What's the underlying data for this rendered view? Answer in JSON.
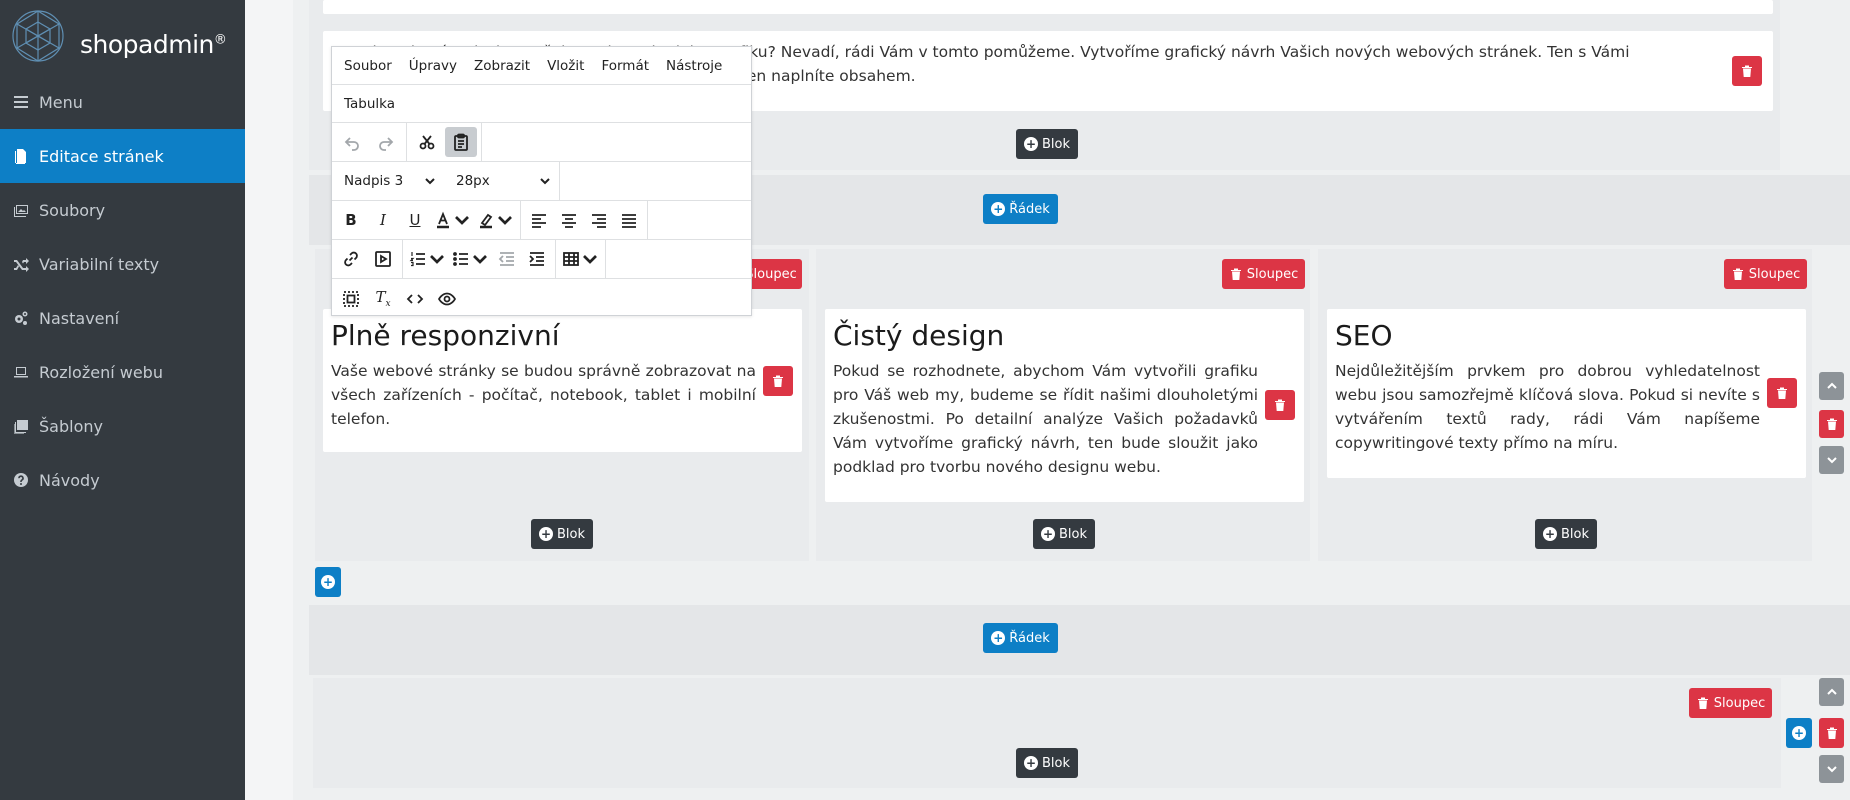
{
  "app": {
    "logo_text": "shopadmin",
    "logo_mark": "®"
  },
  "sidebar": {
    "items": [
      {
        "label": "Menu",
        "icon": "bars-icon",
        "active": false
      },
      {
        "label": "Editace stránek",
        "icon": "file-icon",
        "active": true
      },
      {
        "label": "Soubory",
        "icon": "images-icon",
        "active": false
      },
      {
        "label": "Variabilní texty",
        "icon": "shuffle-icon",
        "active": false
      },
      {
        "label": "Nastavení",
        "icon": "cogs-icon",
        "active": false
      },
      {
        "label": "Rozložení webu",
        "icon": "laptop-icon",
        "active": false
      },
      {
        "label": "Šablony",
        "icon": "templates-icon",
        "active": false
      },
      {
        "label": "Návody",
        "icon": "question-icon",
        "active": false
      }
    ]
  },
  "colors": {
    "sidebar_bg": "#343a40",
    "active": "#0d7fc6",
    "danger": "#dc3545",
    "dark_button": "#343a40"
  },
  "top_block": {
    "text_line1": "Nevyhovuje Vám design vašeho webu nebo jeho grafiku? Nevadí, rádi Vám v tomto pomůžeme. Vytvoříme grafický návrh Vašich nových webových stránek. Ten s Vámi",
    "text_line2": "konzultujeme a následně vytvoříme web, který si už jen naplníte obsahem."
  },
  "buttons": {
    "blok": "Blok",
    "radek": "Řádek",
    "sloupec": "Sloupec"
  },
  "columns": [
    {
      "title": "Plně responzivní",
      "text": "Vaše webové stránky se budou správně zobrazovat na všech zařízeních - počítač, notebook, tablet i mobilní telefon."
    },
    {
      "title": "Čistý design",
      "text": "Pokud se rozhodnete, abychom Vám vytvořili grafiku pro Váš web my, budeme se řídit našimi dlouholetými zkušenostmi. Po detailní analýze Vašich požadavků Vám vytvoříme grafický návrh, ten bude sloužit jako podklad pro tvorbu nového designu webu."
    },
    {
      "title": "SEO",
      "text": "Nejdůležitějším prvkem pro dobrou vyhledatelnost webu jsou samozřejmě klíčová slova. Pokud si nevíte s vytvářením textů rady, rádi Vám napíšeme copywritingové texty přímo na míru."
    }
  ],
  "editor": {
    "menu": [
      "Soubor",
      "Úpravy",
      "Zobrazit",
      "Vložit",
      "Formát",
      "Nástroje"
    ],
    "menu2": "Tabulka",
    "block_format": "Nadpis 3",
    "font_size": "28px"
  }
}
